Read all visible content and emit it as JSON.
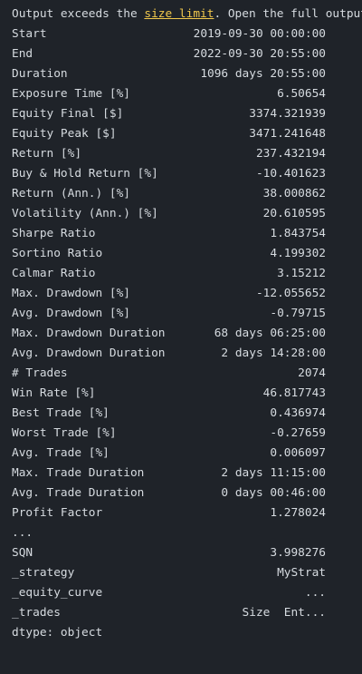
{
  "notice": {
    "prefix": "Output exceeds the ",
    "link": "size limit",
    "suffix": ". Open the full output data in a text editor"
  },
  "stats": [
    {
      "key": "Start",
      "value": "2019-09-30 00:00:00"
    },
    {
      "key": "End",
      "value": "2022-09-30 20:55:00"
    },
    {
      "key": "Duration",
      "value": "1096 days 20:55:00"
    },
    {
      "key": "Exposure Time [%]",
      "value": "6.50654"
    },
    {
      "key": "Equity Final [$]",
      "value": "3374.321939"
    },
    {
      "key": "Equity Peak [$]",
      "value": "3471.241648"
    },
    {
      "key": "Return [%]",
      "value": "237.432194"
    },
    {
      "key": "Buy & Hold Return [%]",
      "value": "-10.401623"
    },
    {
      "key": "Return (Ann.) [%]",
      "value": "38.000862"
    },
    {
      "key": "Volatility (Ann.) [%]",
      "value": "20.610595"
    },
    {
      "key": "Sharpe Ratio",
      "value": "1.843754"
    },
    {
      "key": "Sortino Ratio",
      "value": "4.199302"
    },
    {
      "key": "Calmar Ratio",
      "value": "3.15212"
    },
    {
      "key": "Max. Drawdown [%]",
      "value": "-12.055652"
    },
    {
      "key": "Avg. Drawdown [%]",
      "value": "-0.79715"
    },
    {
      "key": "Max. Drawdown Duration",
      "value": "68 days 06:25:00"
    },
    {
      "key": "Avg. Drawdown Duration",
      "value": "2 days 14:28:00"
    },
    {
      "key": "# Trades",
      "value": "2074"
    },
    {
      "key": "Win Rate [%]",
      "value": "46.817743"
    },
    {
      "key": "Best Trade [%]",
      "value": "0.436974"
    },
    {
      "key": "Worst Trade [%]",
      "value": "-0.27659"
    },
    {
      "key": "Avg. Trade [%]",
      "value": "0.006097"
    },
    {
      "key": "Max. Trade Duration",
      "value": "2 days 11:15:00"
    },
    {
      "key": "Avg. Trade Duration",
      "value": "0 days 00:46:00"
    },
    {
      "key": "Profit Factor",
      "value": "1.278024"
    }
  ],
  "ellipsis": "...",
  "tail_stats": [
    {
      "key": "SQN",
      "value": "3.998276"
    },
    {
      "key": "_strategy",
      "value": "MyStrat"
    },
    {
      "key": "_equity_curve",
      "value": "..."
    },
    {
      "key": "_trades",
      "value": "Size  Ent..."
    }
  ],
  "dtype_line": "dtype: object"
}
